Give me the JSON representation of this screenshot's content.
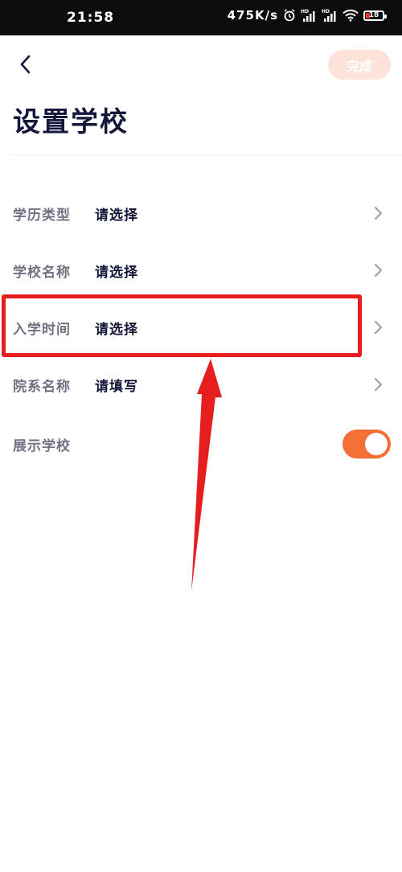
{
  "status_bar": {
    "time": "21:58",
    "net_speed": "475K/s",
    "battery_level": "18",
    "icons": [
      "alarm-icon",
      "hd-signal-icon",
      "hd-signal-icon",
      "wifi-icon",
      "battery-icon"
    ]
  },
  "header": {
    "back_icon": "chevron-left-icon",
    "done_label": "完成",
    "title": "设置学校"
  },
  "form": {
    "rows": [
      {
        "label": "学历类型",
        "value": "请选择"
      },
      {
        "label": "学校名称",
        "value": "请选择"
      },
      {
        "label": "入学时间",
        "value": "请选择"
      },
      {
        "label": "院系名称",
        "value": "请填写"
      }
    ],
    "toggle_row": {
      "label": "展示学校",
      "on": true
    }
  },
  "colors": {
    "accent": "#f36f35",
    "done_button_bg": "#fde3d9",
    "title_text": "#14163a",
    "label_text": "#6f7283",
    "annotation_red": "#e61e1e"
  }
}
